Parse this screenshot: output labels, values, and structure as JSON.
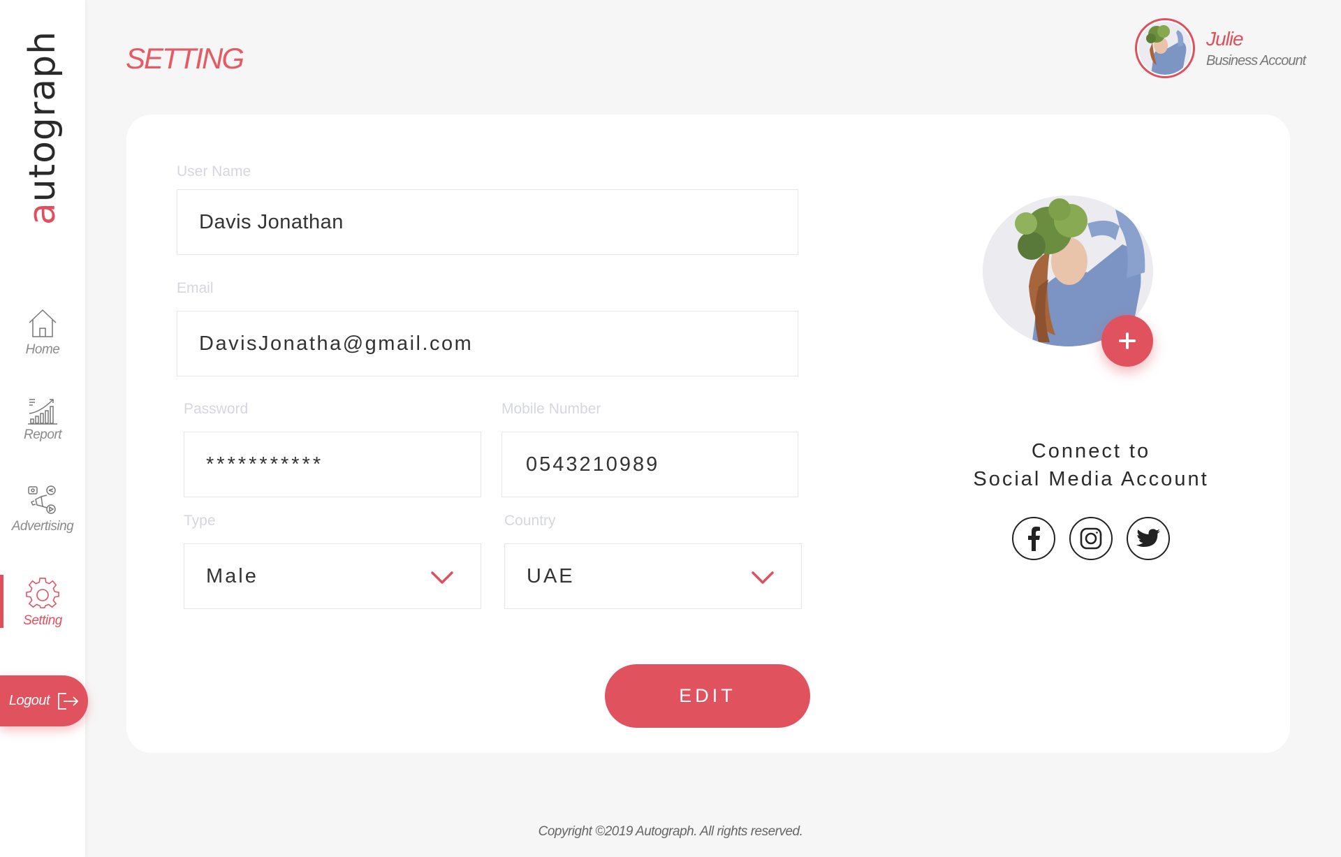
{
  "brand": {
    "logo_text_accent": "a",
    "logo_text_rest": "utograph",
    "accent_color": "#e0505c"
  },
  "page": {
    "title": "SETTING"
  },
  "profile": {
    "name": "Julie",
    "account_type": "Business Account"
  },
  "sidebar": {
    "items": [
      {
        "label": "Home",
        "icon": "home-icon",
        "active": false
      },
      {
        "label": "Report",
        "icon": "chart-icon",
        "active": false
      },
      {
        "label": "Advertising",
        "icon": "advertising-icon",
        "active": false
      },
      {
        "label": "Setting",
        "icon": "gear-icon",
        "active": true
      }
    ],
    "logout_label": "Logout"
  },
  "form": {
    "username": {
      "label": "User Name",
      "value": "Davis Jonathan"
    },
    "email": {
      "label": "Email",
      "value": "DavisJonatha@gmail.com"
    },
    "password": {
      "label": "Password",
      "value": "***********"
    },
    "mobile": {
      "label": "Mobile Number",
      "value": "0543210989"
    },
    "type": {
      "label": "Type",
      "value": "Male"
    },
    "country": {
      "label": "Country",
      "value": "UAE"
    },
    "edit_label": "EDIT"
  },
  "social": {
    "line1": "Connect to",
    "line2": "Social Media Account",
    "icons": [
      "facebook-icon",
      "instagram-icon",
      "twitter-icon"
    ]
  },
  "footer": {
    "copyright": "Copyright ©2019 Autograph. All rights reserved."
  }
}
